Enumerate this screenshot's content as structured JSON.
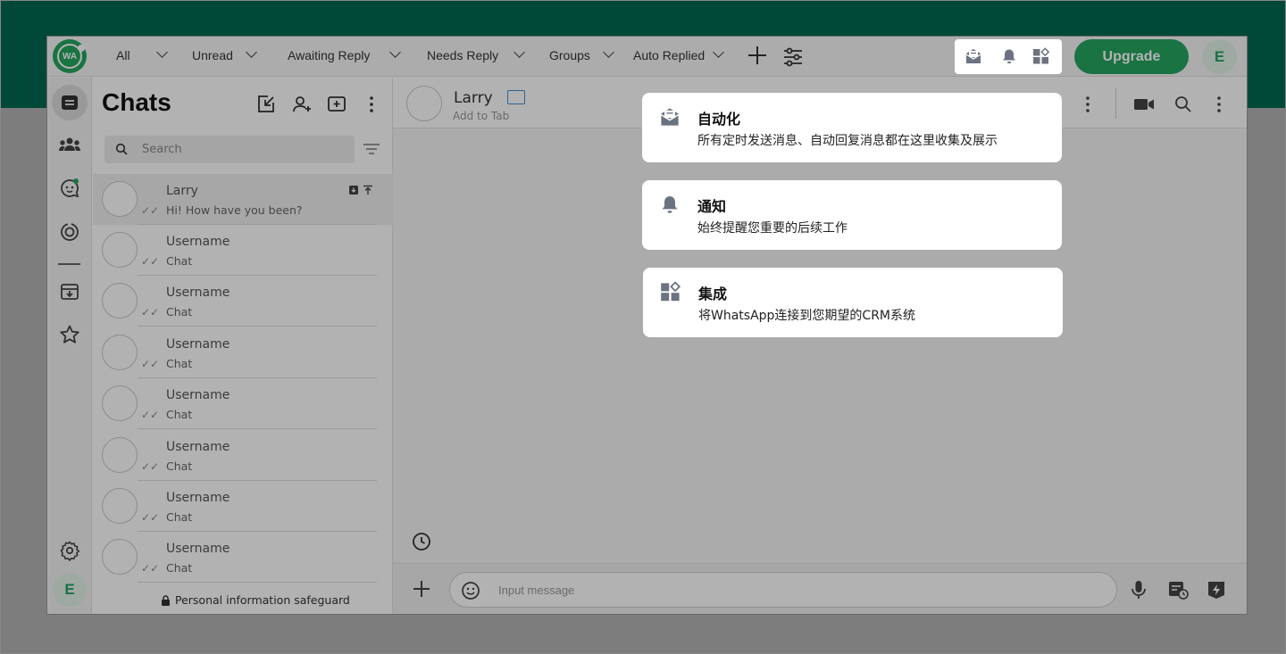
{
  "filters": [
    {
      "label": "All"
    },
    {
      "label": "Unread"
    },
    {
      "label": "Awaiting Reply"
    },
    {
      "label": "Needs Reply"
    },
    {
      "label": "Groups"
    },
    {
      "label": "Auto Replied"
    }
  ],
  "logo_text": "WA",
  "upgrade_label": "Upgrade",
  "user_initial": "E",
  "chats_title": "Chats",
  "search_placeholder": "Search",
  "chats": [
    {
      "name": "Larry",
      "message": "Hi! How have you been?"
    },
    {
      "name": "Username",
      "message": "Chat"
    },
    {
      "name": "Username",
      "message": "Chat"
    },
    {
      "name": "Username",
      "message": "Chat"
    },
    {
      "name": "Username",
      "message": "Chat"
    },
    {
      "name": "Username",
      "message": "Chat"
    },
    {
      "name": "Username",
      "message": "Chat"
    },
    {
      "name": "Username",
      "message": "Chat"
    }
  ],
  "privacy_text": "Personal information safeguard",
  "conversation": {
    "name": "Larry",
    "subtitle": "Add to Tab"
  },
  "composer_placeholder": "Input message",
  "tips": [
    {
      "icon": "automation-inbox-icon",
      "title": "自动化",
      "desc": "所有定时发送消息、自动回复消息都在这里收集及展示"
    },
    {
      "icon": "bell-icon",
      "title": "通知",
      "desc": "始终提醒您重要的后续工作"
    },
    {
      "icon": "integration-icon",
      "title": "集成",
      "desc": "将WhatsApp连接到您期望的CRM系统"
    }
  ],
  "colors": {
    "brand": "#00684f",
    "accent": "#25a55f",
    "overlay": "rgba(0,0,0,0.3)"
  }
}
